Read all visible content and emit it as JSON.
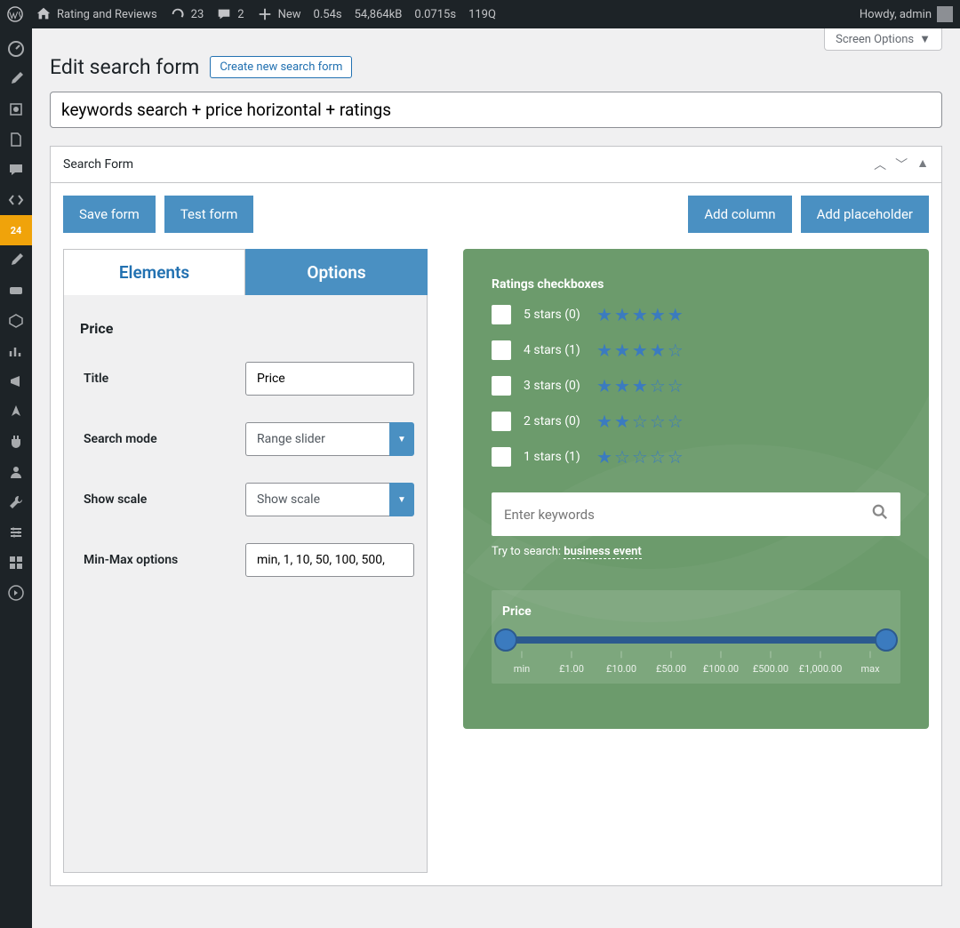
{
  "adminBar": {
    "siteName": "Rating and Reviews",
    "updates": "23",
    "comments": "2",
    "newLabel": "New",
    "perf1": "0.54s",
    "perf2": "54,864kB",
    "perf3": "0.0715s",
    "perf4": "119Q",
    "howdy": "Howdy, admin"
  },
  "screenOptions": "Screen Options",
  "page": {
    "title": "Edit search form",
    "createLink": "Create new search form",
    "formName": "keywords search + price horizontal + ratings"
  },
  "panel": {
    "title": "Search Form"
  },
  "buttons": {
    "save": "Save form",
    "test": "Test form",
    "addColumn": "Add column",
    "addPlaceholder": "Add placeholder"
  },
  "tabs": {
    "elements": "Elements",
    "options": "Options"
  },
  "editor": {
    "sectionTitle": "Price",
    "fields": {
      "titleLabel": "Title",
      "titleValue": "Price",
      "searchModeLabel": "Search mode",
      "searchModeValue": "Range slider",
      "showScaleLabel": "Show scale",
      "showScaleValue": "Show scale",
      "minMaxLabel": "Min-Max options",
      "minMaxValue": "min, 1, 10, 50, 100, 500,"
    }
  },
  "preview": {
    "ratingsTitle": "Ratings checkboxes",
    "ratings": [
      {
        "label": "5 stars (0)",
        "filled": 5
      },
      {
        "label": "4 stars (1)",
        "filled": 4
      },
      {
        "label": "3 stars (0)",
        "filled": 3
      },
      {
        "label": "2 stars (0)",
        "filled": 2
      },
      {
        "label": "1 stars (1)",
        "filled": 1
      }
    ],
    "searchPlaceholder": "Enter keywords",
    "trySearchLabel": "Try to search:",
    "trySearchLink": "business event",
    "priceTitle": "Price",
    "ticks": [
      "min",
      "£1.00",
      "£10.00",
      "£50.00",
      "£100.00",
      "£500.00",
      "£1,000.00",
      "max"
    ]
  }
}
